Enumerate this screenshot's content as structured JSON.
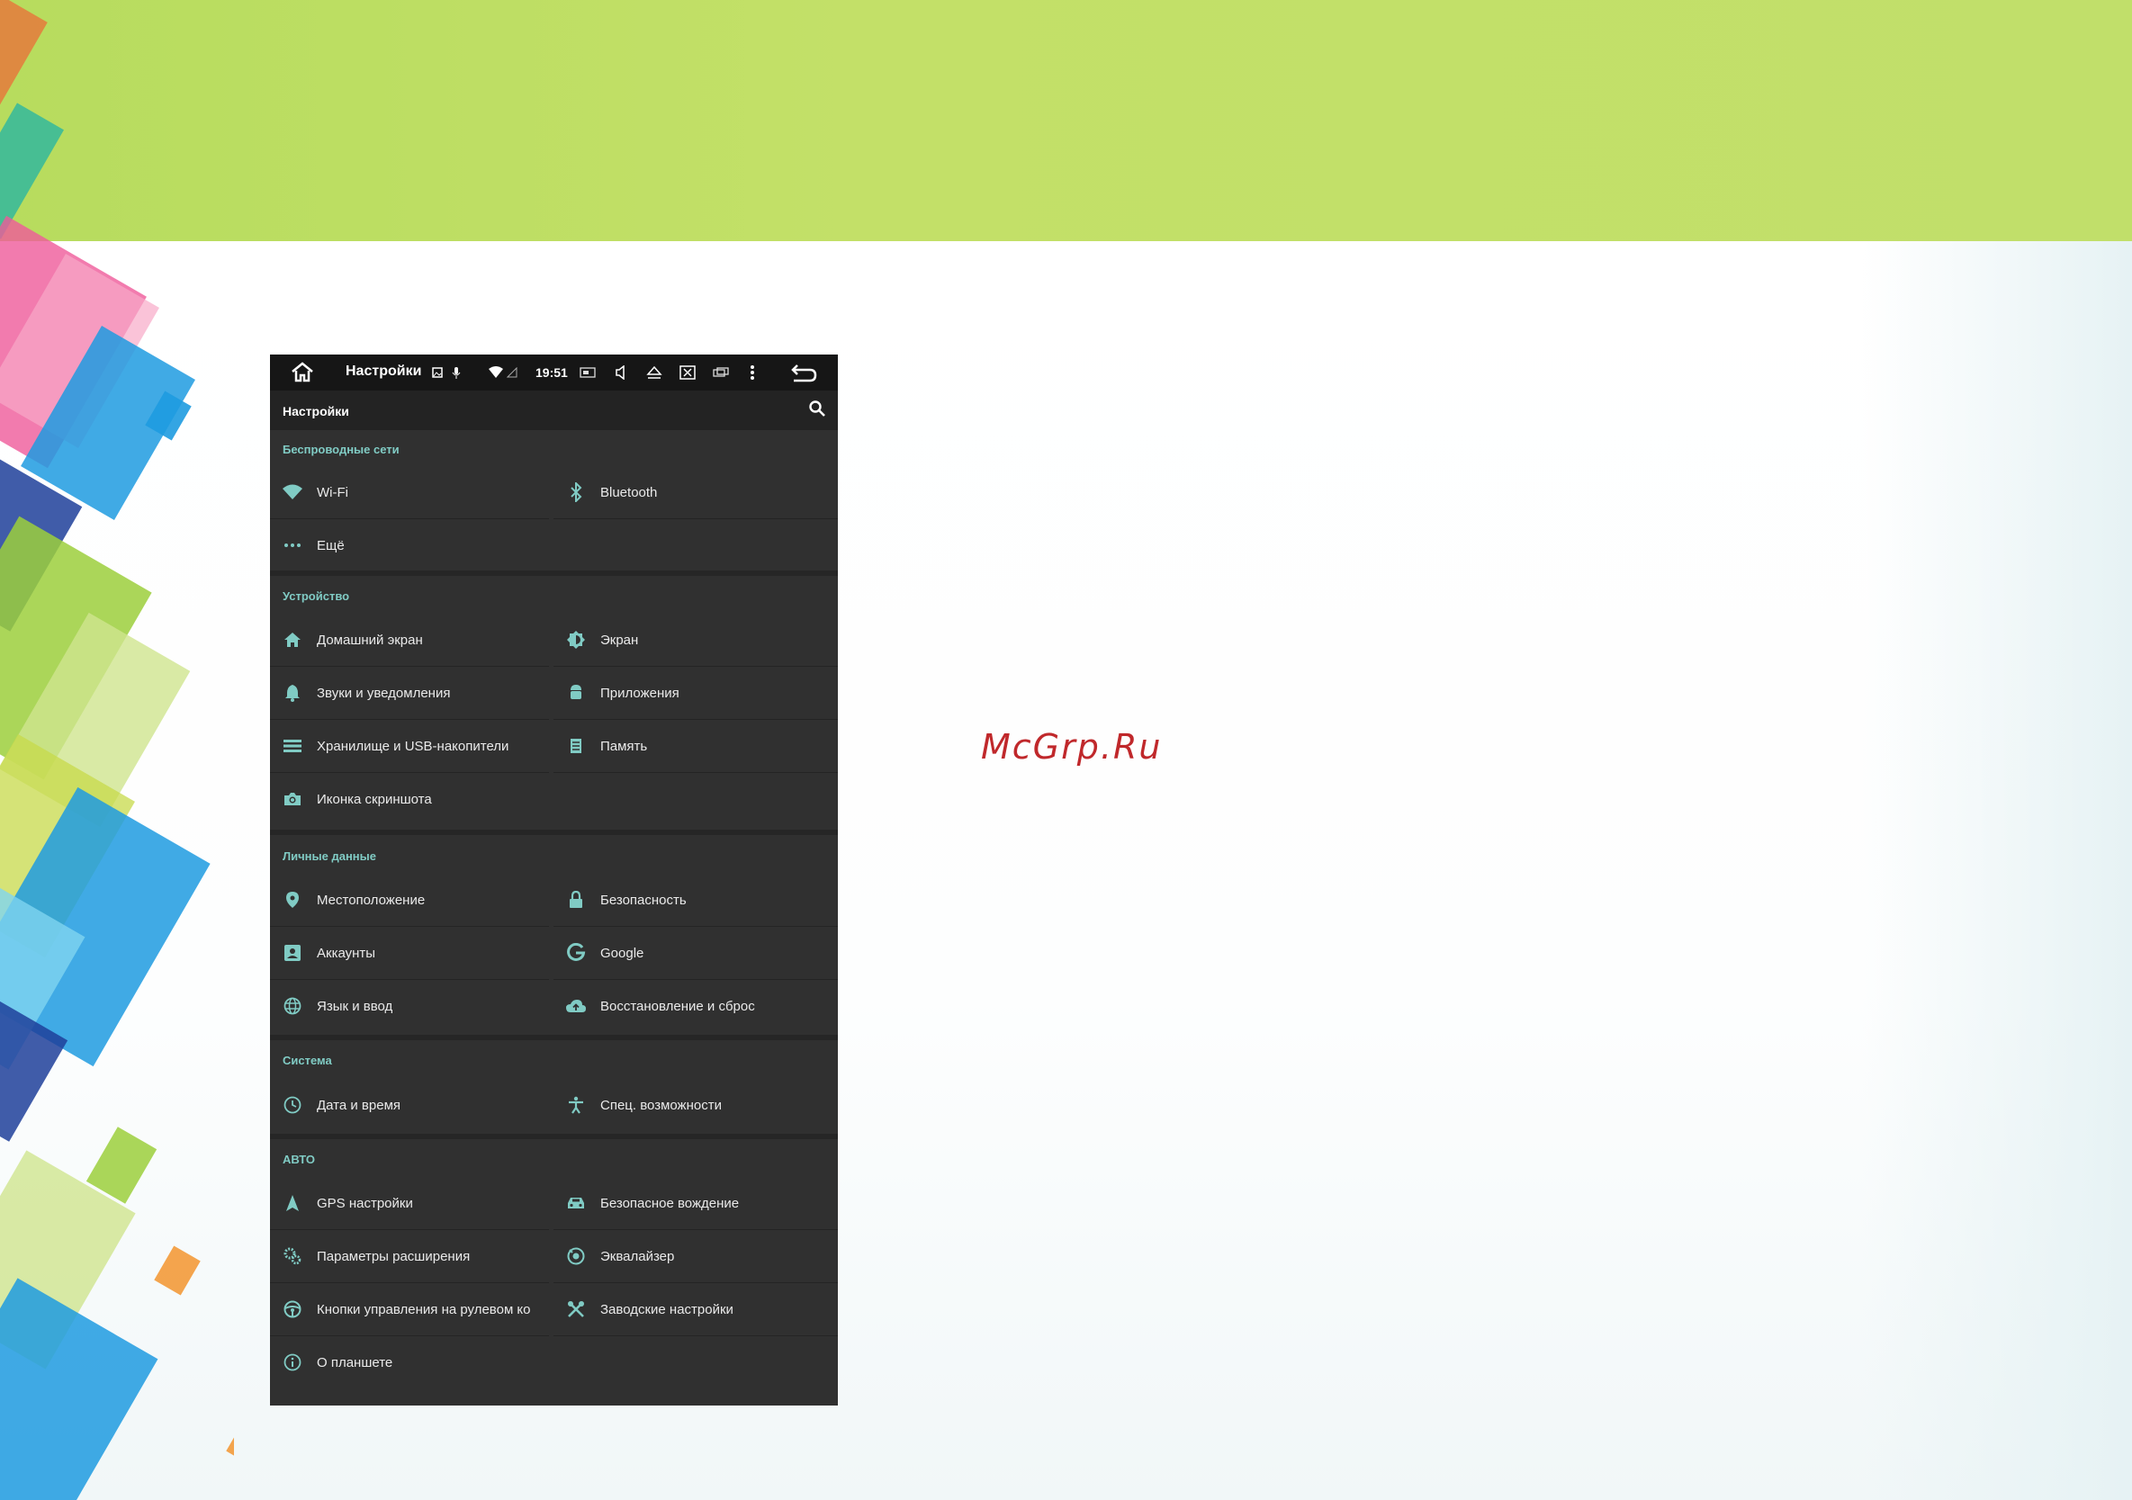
{
  "statusbar": {
    "title": "Настройки",
    "time": "19:51",
    "icons": [
      "home-icon",
      "image-icon",
      "mic-icon",
      "wifi-icon",
      "signal-icon",
      "screen-icon",
      "volume-icon",
      "eject-icon",
      "close-box-icon",
      "window-icon",
      "more-vert-icon",
      "back-icon"
    ]
  },
  "appbar": {
    "title": "Настройки",
    "icon": "search-icon"
  },
  "sections": [
    {
      "title": "Беспроводные сети",
      "items": [
        {
          "label": "Wi-Fi",
          "icon": "wifi-icon"
        },
        {
          "label": "Bluetooth",
          "icon": "bluetooth-icon"
        },
        {
          "label": "Ещё",
          "icon": "more-horiz-icon"
        }
      ]
    },
    {
      "title": "Устройство",
      "items": [
        {
          "label": "Домашний экран",
          "icon": "home-icon"
        },
        {
          "label": "Экран",
          "icon": "brightness-icon"
        },
        {
          "label": "Звуки и уведомления",
          "icon": "bell-icon"
        },
        {
          "label": "Приложения",
          "icon": "android-icon"
        },
        {
          "label": "Хранилище и USB-накопители",
          "icon": "storage-icon"
        },
        {
          "label": "Память",
          "icon": "memory-icon"
        },
        {
          "label": "Иконка скриншота",
          "icon": "camera-icon"
        }
      ]
    },
    {
      "title": "Личные данные",
      "items": [
        {
          "label": "Местоположение",
          "icon": "location-icon"
        },
        {
          "label": "Безопасность",
          "icon": "lock-icon"
        },
        {
          "label": "Аккаунты",
          "icon": "account-icon"
        },
        {
          "label": "Google",
          "icon": "google-icon"
        },
        {
          "label": "Язык и ввод",
          "icon": "globe-icon"
        },
        {
          "label": "Восстановление и сброс",
          "icon": "cloud-upload-icon"
        }
      ]
    },
    {
      "title": "Система",
      "items": [
        {
          "label": "Дата и время",
          "icon": "clock-icon"
        },
        {
          "label": "Спец. возможности",
          "icon": "accessibility-icon"
        }
      ]
    },
    {
      "title": "АВТО",
      "items": [
        {
          "label": "GPS настройки",
          "icon": "navigation-icon"
        },
        {
          "label": "Безопасное вождение",
          "icon": "car-icon"
        },
        {
          "label": "Параметры расширения",
          "icon": "gears-icon"
        },
        {
          "label": "Эквалайзер",
          "icon": "equalizer-icon"
        },
        {
          "label": "Кнопки управления на рулевом ко",
          "icon": "steering-wheel-icon"
        },
        {
          "label": "Заводские настройки",
          "icon": "wrench-icon"
        },
        {
          "label": "О планшете",
          "icon": "info-icon"
        }
      ]
    }
  ],
  "watermark": "McGrp.Ru",
  "colors": {
    "accent": "#80cbc4",
    "panel": "#303030",
    "statusbar": "#161616",
    "banner": "#c1df6a",
    "watermark": "#c0282b"
  }
}
